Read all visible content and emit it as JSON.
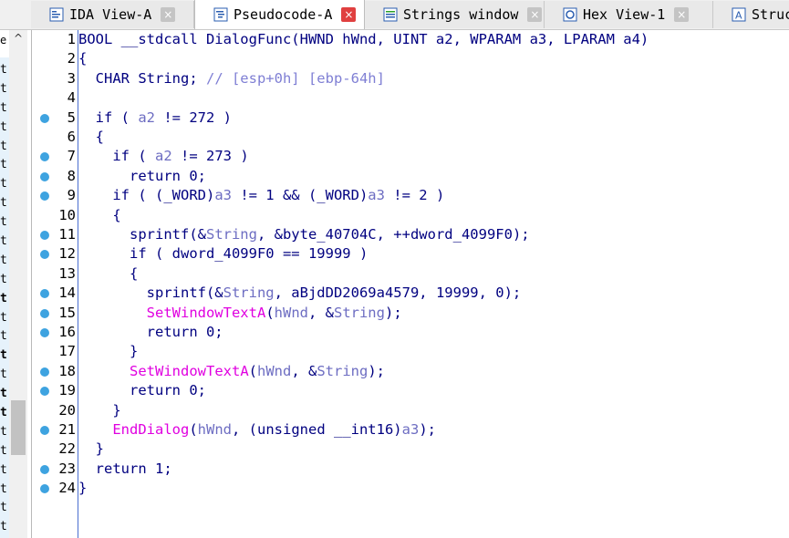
{
  "tabs": [
    {
      "label": "IDA View-A",
      "icon": "ida-view-icon",
      "active": false
    },
    {
      "label": "Pseudocode-A",
      "icon": "pseudocode-icon",
      "active": true
    },
    {
      "label": "Strings window",
      "icon": "strings-icon",
      "active": false
    },
    {
      "label": "Hex View-1",
      "icon": "hex-view-icon",
      "active": false
    },
    {
      "label": "Struc",
      "icon": "structures-icon",
      "active": false
    }
  ],
  "close_glyph": "×",
  "left_panel": {
    "top_text": "e",
    "scroll_up_glyph": "^",
    "letters": [
      "t",
      "t",
      "t",
      "t",
      "t",
      "t",
      "t",
      "t",
      "t",
      "t",
      "t",
      "t",
      "t",
      "t",
      "t",
      "t",
      "t",
      "t",
      "t",
      "t",
      "t",
      "t",
      "t",
      "t",
      "t",
      "t"
    ],
    "bold_indices": [
      12,
      15,
      17,
      18
    ]
  },
  "colors": {
    "keyword": "#000080",
    "variable": "#6d6dc2",
    "comment": "#7f7fd4",
    "api_function": "#e000e0",
    "breakpoint": "#3ea3e0",
    "active_close": "#e04040"
  },
  "code": [
    {
      "n": "1",
      "bp": false,
      "tokens": [
        [
          "BOOL __stdcall DialogFunc(HWND hWnd, UINT a2, WPARAM a3, LPARAM a4)",
          "pl"
        ]
      ]
    },
    {
      "n": "2",
      "bp": false,
      "tokens": [
        [
          "{",
          "pl"
        ]
      ]
    },
    {
      "n": "3",
      "bp": false,
      "tokens": [
        [
          "  CHAR String; ",
          "pl"
        ],
        [
          "// [esp+0h] [ebp-64h]",
          "cm"
        ]
      ]
    },
    {
      "n": "4",
      "bp": false,
      "tokens": []
    },
    {
      "n": "5",
      "bp": true,
      "tokens": [
        [
          "  if ( ",
          "pl"
        ],
        [
          "a2",
          "var"
        ],
        [
          " != 272 )",
          "pl"
        ]
      ]
    },
    {
      "n": "6",
      "bp": false,
      "tokens": [
        [
          "  {",
          "pl"
        ]
      ]
    },
    {
      "n": "7",
      "bp": true,
      "tokens": [
        [
          "    if ( ",
          "pl"
        ],
        [
          "a2",
          "var"
        ],
        [
          " != 273 )",
          "pl"
        ]
      ]
    },
    {
      "n": "8",
      "bp": true,
      "tokens": [
        [
          "      return 0;",
          "pl"
        ]
      ]
    },
    {
      "n": "9",
      "bp": true,
      "tokens": [
        [
          "    if ( (_WORD)",
          "pl"
        ],
        [
          "a3",
          "var"
        ],
        [
          " != 1 && (_WORD)",
          "pl"
        ],
        [
          "a3",
          "var"
        ],
        [
          " != 2 )",
          "pl"
        ]
      ]
    },
    {
      "n": "10",
      "bp": false,
      "tokens": [
        [
          "    {",
          "pl"
        ]
      ]
    },
    {
      "n": "11",
      "bp": true,
      "tokens": [
        [
          "      sprintf(&",
          "pl"
        ],
        [
          "String",
          "var"
        ],
        [
          ", &byte_40704C, ++dword_4099F0);",
          "pl"
        ]
      ]
    },
    {
      "n": "12",
      "bp": true,
      "tokens": [
        [
          "      if ( dword_4099F0 == 19999 )",
          "pl"
        ]
      ]
    },
    {
      "n": "13",
      "bp": false,
      "tokens": [
        [
          "      {",
          "pl"
        ]
      ]
    },
    {
      "n": "14",
      "bp": true,
      "tokens": [
        [
          "        sprintf(&",
          "pl"
        ],
        [
          "String",
          "var"
        ],
        [
          ", aBjdDD2069a4579, 19999, 0);",
          "pl"
        ]
      ]
    },
    {
      "n": "15",
      "bp": true,
      "tokens": [
        [
          "        ",
          "pl"
        ],
        [
          "SetWindowTextA",
          "fn"
        ],
        [
          "(",
          "pl"
        ],
        [
          "hWnd",
          "var"
        ],
        [
          ", &",
          "pl"
        ],
        [
          "String",
          "var"
        ],
        [
          ");",
          "pl"
        ]
      ]
    },
    {
      "n": "16",
      "bp": true,
      "tokens": [
        [
          "        return 0;",
          "pl"
        ]
      ]
    },
    {
      "n": "17",
      "bp": false,
      "tokens": [
        [
          "      }",
          "pl"
        ]
      ]
    },
    {
      "n": "18",
      "bp": true,
      "tokens": [
        [
          "      ",
          "pl"
        ],
        [
          "SetWindowTextA",
          "fn"
        ],
        [
          "(",
          "pl"
        ],
        [
          "hWnd",
          "var"
        ],
        [
          ", &",
          "pl"
        ],
        [
          "String",
          "var"
        ],
        [
          ");",
          "pl"
        ]
      ]
    },
    {
      "n": "19",
      "bp": true,
      "tokens": [
        [
          "      return 0;",
          "pl"
        ]
      ]
    },
    {
      "n": "20",
      "bp": false,
      "tokens": [
        [
          "    }",
          "pl"
        ]
      ]
    },
    {
      "n": "21",
      "bp": true,
      "tokens": [
        [
          "    ",
          "pl"
        ],
        [
          "EndDialog",
          "fn"
        ],
        [
          "(",
          "pl"
        ],
        [
          "hWnd",
          "var"
        ],
        [
          ", (unsigned __int16)",
          "pl"
        ],
        [
          "a3",
          "var"
        ],
        [
          ");",
          "pl"
        ]
      ]
    },
    {
      "n": "22",
      "bp": false,
      "tokens": [
        [
          "  }",
          "pl"
        ]
      ]
    },
    {
      "n": "23",
      "bp": true,
      "tokens": [
        [
          "  return 1;",
          "pl"
        ]
      ]
    },
    {
      "n": "24",
      "bp": true,
      "tokens": [
        [
          "}",
          "pl"
        ]
      ]
    }
  ]
}
